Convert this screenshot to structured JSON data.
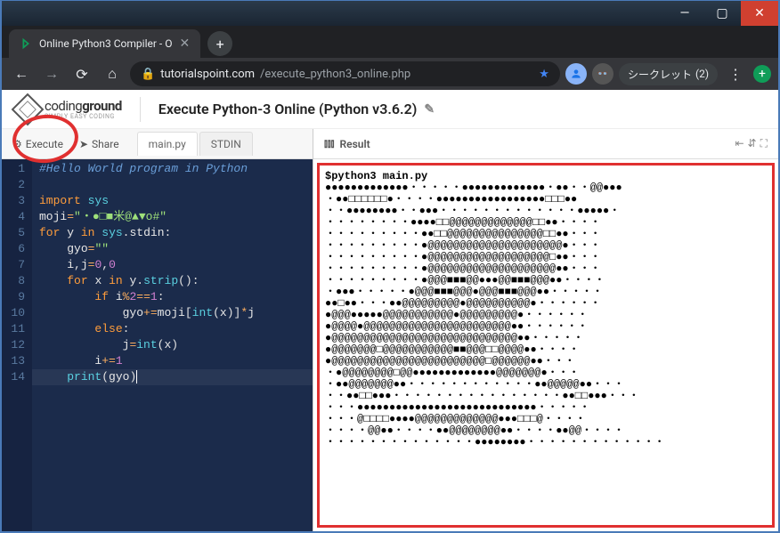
{
  "window": {
    "tab_title": "Online Python3 Compiler - O",
    "url_domain": "tutorialspoint.com",
    "url_path": "/execute_python3_online.php",
    "incognito_label": "シークレット",
    "incognito_count": "(2)"
  },
  "page": {
    "logo_main": "coding",
    "logo_bold": "ground",
    "logo_sub": "SIMPLY EASY CODING",
    "title": "Execute Python-3 Online (Python v3.6.2)"
  },
  "toolbar": {
    "execute": "Execute",
    "share": "Share",
    "tabs": [
      "main.py",
      "STDIN"
    ]
  },
  "result": {
    "title": "Result",
    "prompt": "$python3 main.py"
  },
  "editor": {
    "lines": [
      {
        "n": 1,
        "html": "<span class='tok-comment'>#Hello World program in Python</span>"
      },
      {
        "n": 2,
        "html": ""
      },
      {
        "n": 3,
        "html": "<span class='tok-keyword'>import</span> <span class='tok-builtin'>sys</span>"
      },
      {
        "n": 4,
        "html": "<span class='tok-ident'>moji</span><span class='tok-op'>=</span><span class='tok-string'>\"・●□■米@▲▼o#\"</span>"
      },
      {
        "n": 5,
        "html": "<span class='tok-keyword'>for</span> <span class='tok-ident'>y</span> <span class='tok-keyword'>in</span> <span class='tok-builtin'>sys</span>.<span class='tok-ident'>stdin</span>:"
      },
      {
        "n": 6,
        "html": "    <span class='tok-ident'>gyo</span><span class='tok-op'>=</span><span class='tok-string'>\"\"</span>"
      },
      {
        "n": 7,
        "html": "    <span class='tok-ident'>i</span>,<span class='tok-ident'>j</span><span class='tok-op'>=</span><span class='tok-num'>0</span>,<span class='tok-num'>0</span>"
      },
      {
        "n": 8,
        "html": "    <span class='tok-keyword'>for</span> <span class='tok-ident'>x</span> <span class='tok-keyword'>in</span> <span class='tok-ident'>y</span>.<span class='tok-func'>strip</span>():"
      },
      {
        "n": 9,
        "html": "        <span class='tok-keyword'>if</span> <span class='tok-ident'>i</span><span class='tok-op'>%</span><span class='tok-num'>2</span><span class='tok-op'>==</span><span class='tok-num'>1</span>:"
      },
      {
        "n": 10,
        "html": "            <span class='tok-ident'>gyo</span><span class='tok-op'>+=</span><span class='tok-ident'>moji</span>[<span class='tok-func'>int</span>(<span class='tok-ident'>x</span>)]<span class='tok-op'>*</span><span class='tok-ident'>j</span>"
      },
      {
        "n": 11,
        "html": "        <span class='tok-keyword'>else</span>:"
      },
      {
        "n": 12,
        "html": "            <span class='tok-ident'>j</span><span class='tok-op'>=</span><span class='tok-func'>int</span>(<span class='tok-ident'>x</span>)"
      },
      {
        "n": 13,
        "html": "        <span class='tok-ident'>i</span><span class='tok-op'>+=</span><span class='tok-num'>1</span>"
      },
      {
        "n": 14,
        "html": "    <span class='tok-func'>print</span>(<span class='tok-ident'>gyo</span>)<span class='cursor'></span>",
        "hl": true
      }
    ]
  },
  "terminal_output_lines": [
    "●●●●●●●●●●●●●・・・・・●●●●●●●●●●●●●・●●・・@@●●●",
    "・●●□□□□□□●・・・・●●●●●●●●●●●●●●●●●□□□●●",
    "・・●●●●●●●●・・●●●・・・・・・・・・・・・・●●●●●・",
    "・・・・・・・・●●●●□□@@@@@@@@@@@@@□□●●・・・・",
    "・・・・・・・・・●●□□@@@@@@@@@@@@@@@□□●●・・・",
    "・・・・・・・・・●@@@@@@@@@@@@@@@@@@@@@●・・・",
    "・・・・・・・・・●@@@@@@@@@@@@@@@@@@@□●●・・・",
    "・・・・・・・・・●@@@@@@@@@@@@@@@@@@@@●●・・・",
    "・・・・・・・・・●@@@■■■@@●●●@@■■■@@@●●・・・・",
    "・●●●・・・・・●@@@■■■@@@●@@@■■■@@@●●・・・・・",
    "●●□●●・・・●●@@@@@@@@@●@@@@@@@@@@●・・・・・・",
    "●@@@●●●●●@@@@@@@@@@@●@@@@@@@@@●・・・・・・",
    "●@@@@●@@@@@@@@@@@@@@@@@@@@@@@●●・・・・・・",
    "●@@@@@@@@@@@@@@@@@@@@@@@@@@@@@●●・・・・・",
    "●@@@@@@@□@@@@@@@@@@@■■@@@□□@@@@●●・・・・",
    "●@@@@@@@@@@@@@@@@@@@@@@@@□@@@@@@●●・・・",
    "・●@@@@@@@@□@@●●●●●●●●●●●●●@@@@@@@●・・・",
    "・●●@@@@@@@●●・・・・・・・・・・・・●●@@@@@●●・・・",
    "・・●●□□●●●・・・・・・・・・・・・・・・・●●□□●●●・・・",
    "・・・●●●●●●●●●●●●●●●●●●●●●●●●●●●●・・・・・",
    "・・・@□□□□●●●●@@@@@@@@@@@@@●●●□□□@・・・・",
    "・・・・@@●●・・・・●●@@@@@@@@●●・・・・●●@@・・・・",
    "・・・・・・・・・・・・・・●●●●●●●●・・・・・・・・・・・・・"
  ]
}
